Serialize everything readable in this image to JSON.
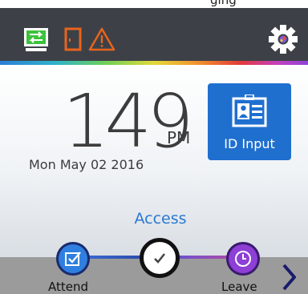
{
  "top_strip": {
    "partial_text": "ging"
  },
  "header": {
    "icons": [
      "sync-status-icon",
      "device-status-icon",
      "warning-icon",
      "settings-gear-icon"
    ]
  },
  "clock": {
    "time": "149",
    "period": "PM",
    "date": "Mon May 02 2016"
  },
  "id_input": {
    "label": "ID Input",
    "icon": "id-card-icon"
  },
  "mode": {
    "label": "Access"
  },
  "steps": [
    {
      "label": "Attend",
      "icon": "checkbox-edit-icon",
      "color": "#2f7fe0"
    },
    {
      "label": "",
      "icon": "check-icon",
      "color": "#ffffff"
    },
    {
      "label": "Leave",
      "icon": "clock-icon",
      "color": "#8d3fd6"
    }
  ],
  "colors": {
    "header_bg": "#3d4147",
    "accent_blue": "#1f6fcf",
    "warning": "#e8641c",
    "sync_green": "#3cc23c"
  }
}
